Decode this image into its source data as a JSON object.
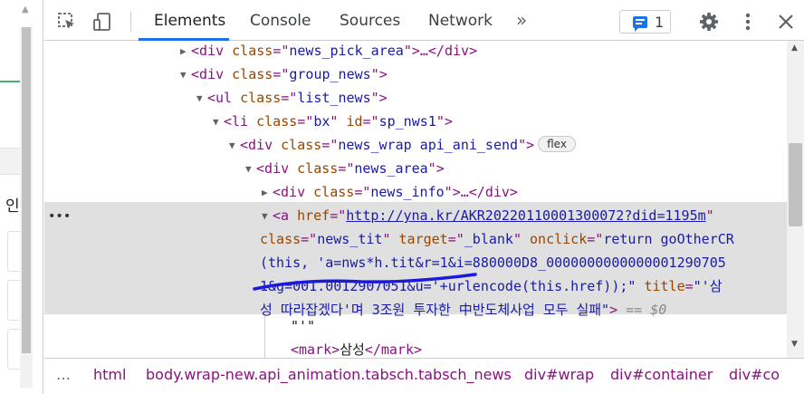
{
  "page": {
    "visible_char": "인"
  },
  "toolbar": {
    "tabs": [
      "Elements",
      "Console",
      "Sources",
      "Network"
    ],
    "more_tabs": "»",
    "issues_count": "1",
    "accent": "#1a73e8"
  },
  "tree": {
    "lines": [
      {
        "open": "<",
        "tag": "div",
        "attr": "class",
        "value": "news_pick_area",
        "tail_close": ">…</",
        "tail_tag": "div",
        "tail_end": ">"
      },
      {
        "open": "<",
        "tag": "div",
        "attr": "class",
        "value": "group_news",
        "end": ">"
      },
      {
        "open": "<",
        "tag": "ul",
        "attr": "class",
        "value": "list_news",
        "end": ">"
      },
      {
        "open": "<",
        "tag": "li",
        "attr": "class",
        "value": "bx",
        "attr2": "id",
        "value2": "sp_nws1",
        "end": ">"
      },
      {
        "open": "<",
        "tag": "div",
        "attr": "class",
        "value": "news_wrap api_ani_send",
        "end": ">",
        "badge": "flex"
      },
      {
        "open": "<",
        "tag": "div",
        "attr": "class",
        "value": "news_area",
        "end": ">"
      },
      {
        "open": "<",
        "tag": "div",
        "attr": "class",
        "value": "news_info",
        "tail_close": ">…</",
        "tail_tag": "div",
        "tail_end": ">"
      }
    ],
    "selected": {
      "line1": {
        "tag": "a",
        "attr": "href",
        "url": "http://yna.kr/AKR20220110001300072?did=1195m"
      },
      "line2": {
        "attr_class": "class",
        "class_value": "news_tit",
        "attr_target": "target",
        "target_value": "_blank",
        "attr_onclick": "onclick",
        "onclick_value_start": "return goOtherCR"
      },
      "line3": "(this, 'a=nws*h.tit&r=1&i=880000D8_000000000000000129070",
      "line3_end": "5",
      "line4": "1&g=001.0012907051&u='+urlencode(this.href));\"",
      "line4_attr": "title",
      "line4_value_start": "\"'삼",
      "line5_value": "성 따라잡겠다'며 3조원 투자한 中반도체사업 모두 실패\"",
      "line5_end": ">",
      "line5_eq": " == $0"
    },
    "text_node": "\"'\"",
    "mark_tag": "mark",
    "mark_text": "삼성"
  },
  "breadcrumbs": [
    "…",
    "html",
    "body.wrap-new.api_animation.tabsch.tabsch_news",
    "div#wrap",
    "div#container",
    "div#co"
  ],
  "annotation_color": "#1a1adc"
}
